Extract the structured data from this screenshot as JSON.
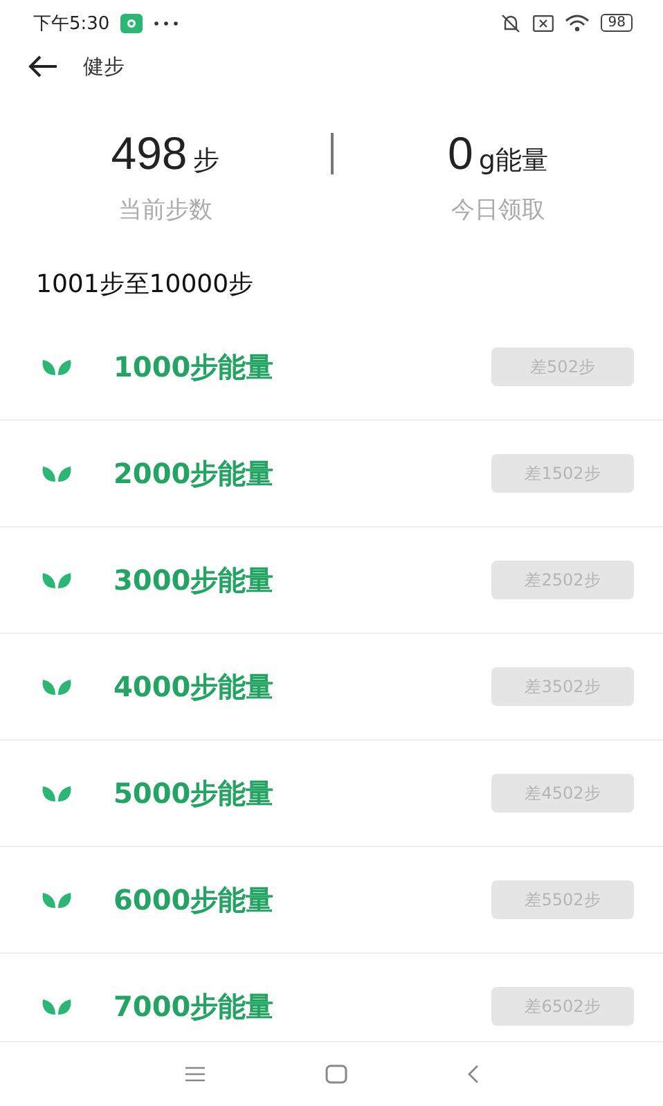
{
  "status_bar": {
    "time": "下午5:30",
    "battery": "98"
  },
  "header": {
    "title": "健步"
  },
  "stats": [
    {
      "value": "498",
      "unit": "步",
      "label": "当前步数"
    },
    {
      "value": "0",
      "unit": "g能量",
      "label": "今日领取"
    }
  ],
  "section_title": "1001步至10000步",
  "rewards": [
    {
      "title": "1000步能量",
      "button": "差502步",
      "disabled": true
    },
    {
      "title": "2000步能量",
      "button": "差1502步",
      "disabled": true
    },
    {
      "title": "3000步能量",
      "button": "差2502步",
      "disabled": true
    },
    {
      "title": "4000步能量",
      "button": "差3502步",
      "disabled": true
    },
    {
      "title": "5000步能量",
      "button": "差4502步",
      "disabled": true
    },
    {
      "title": "6000步能量",
      "button": "差5502步",
      "disabled": true
    },
    {
      "title": "7000步能量",
      "button": "差6502步",
      "disabled": true
    }
  ]
}
